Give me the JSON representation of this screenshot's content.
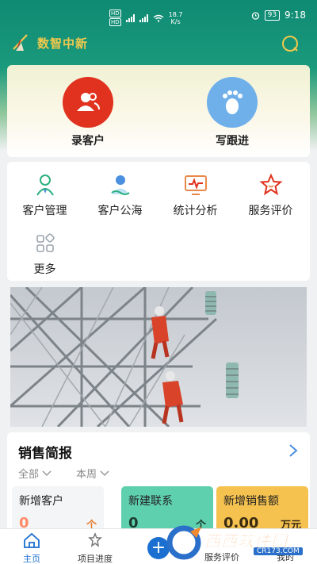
{
  "status_bar": {
    "network_speed": "18.7",
    "speed_unit": "K/s",
    "battery": "93",
    "time": "9:18"
  },
  "header": {
    "title": "数智中新",
    "icons": {
      "logo": "brand-logo",
      "message": "chat-bubble-icon"
    }
  },
  "quick_actions": [
    {
      "label": "录客户",
      "icon": "add-customer-icon",
      "color": "#e0321f"
    },
    {
      "label": "写跟进",
      "icon": "footprint-icon",
      "color": "#5aa7e8"
    }
  ],
  "menu": [
    {
      "label": "客户管理",
      "icon": "person-icon"
    },
    {
      "label": "客户公海",
      "icon": "person-wave-icon"
    },
    {
      "label": "统计分析",
      "icon": "monitor-chart-icon"
    },
    {
      "label": "服务评价",
      "icon": "star-icon"
    },
    {
      "label": "更多",
      "icon": "grid-icon"
    }
  ],
  "sales_report": {
    "title": "销售简报",
    "filters": [
      "全部",
      "本周"
    ],
    "stats": [
      {
        "title": "新增客户",
        "value": "0",
        "unit": "个"
      },
      {
        "title": "新建联系",
        "value": "0",
        "unit": "个"
      },
      {
        "title": "新增销售额",
        "value": "0.00",
        "unit": "万元"
      }
    ]
  },
  "bottom_nav": [
    {
      "label": "主页",
      "icon": "home-icon",
      "active": true
    },
    {
      "label": "项目进度",
      "icon": "progress-icon",
      "active": false
    },
    {
      "label": "服务评价",
      "icon": "add-icon",
      "active": false
    },
    {
      "label": "我的",
      "icon": "profile-icon",
      "active": false
    }
  ],
  "watermark": {
    "text": "西西软件园",
    "url": "CR173.COM"
  },
  "colors": {
    "accent": "#1a6fd0",
    "header_green": "#0f8a73",
    "title_gold": "#f2c94c"
  }
}
